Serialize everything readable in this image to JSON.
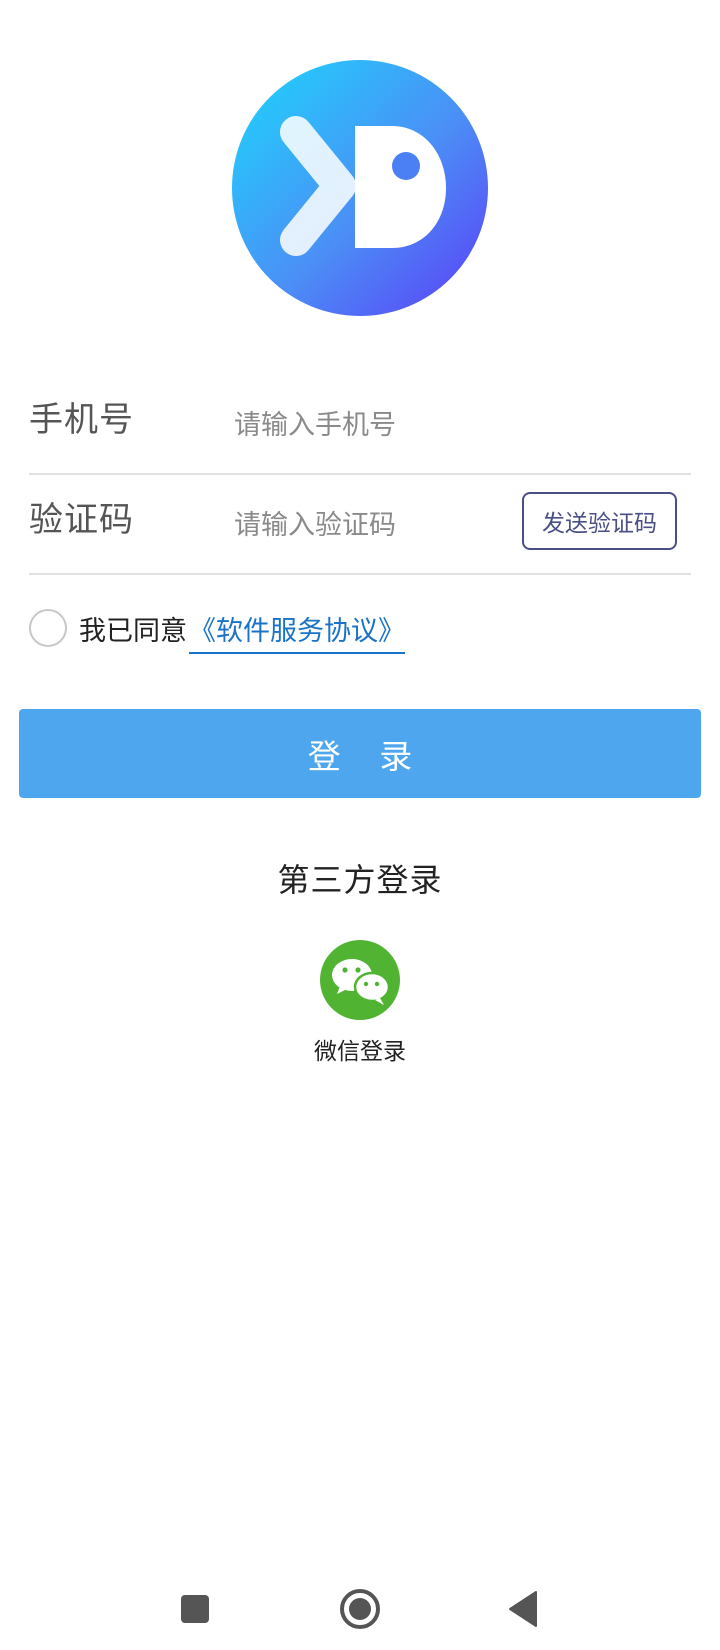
{
  "form": {
    "phone_label": "手机号",
    "phone_placeholder": "请输入手机号",
    "phone_value": "",
    "code_label": "验证码",
    "code_placeholder": "请输入验证码",
    "code_value": "",
    "send_code_label": "发送验证码"
  },
  "agreement": {
    "checked": false,
    "prefix": "我已同意",
    "link_text": "《软件服务协议》"
  },
  "login_button_label": "登 录",
  "third_party": {
    "title": "第三方登录",
    "wechat_label": "微信登录",
    "wechat_icon": "wechat-icon"
  },
  "navbar": {
    "recent_icon": "square-icon",
    "home_icon": "circle-icon",
    "back_icon": "triangle-back-icon"
  },
  "colors": {
    "accent": "#4ea6ee",
    "link": "#1a73c9",
    "wechat_green": "#51b332",
    "logo_gradient_start": "#1cd7fd",
    "logo_gradient_end": "#5b3df6"
  }
}
